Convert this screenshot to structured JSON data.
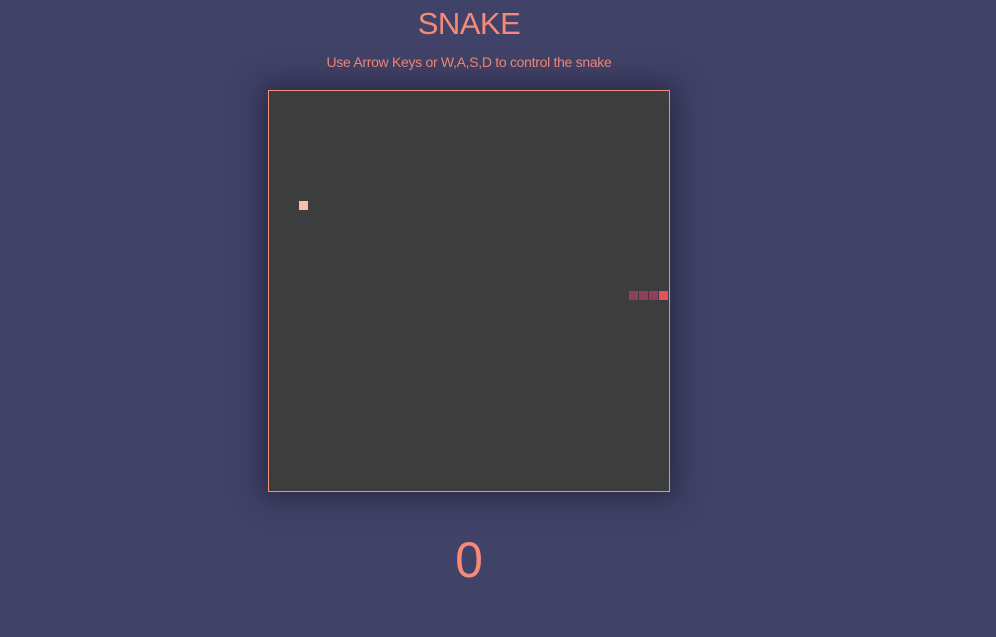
{
  "game": {
    "title": "SNAKE",
    "instructions": "Use Arrow Keys or W,A,S,D to control the snake",
    "score": "0"
  },
  "board": {
    "grid_cells": 40,
    "food": {
      "col": 3,
      "row": 11
    },
    "snake": [
      {
        "col": 39,
        "row": 20,
        "head": true
      },
      {
        "col": 38,
        "row": 20,
        "head": false
      },
      {
        "col": 37,
        "row": 20,
        "head": false
      },
      {
        "col": 36,
        "row": 20,
        "head": false
      }
    ]
  },
  "colors": {
    "background": "#414267",
    "board": "#3d3d3d",
    "accent": "#f5897a",
    "food": "#f6c1a3",
    "snake_head": "#e5505f",
    "snake_body": "#8f3f5a"
  }
}
